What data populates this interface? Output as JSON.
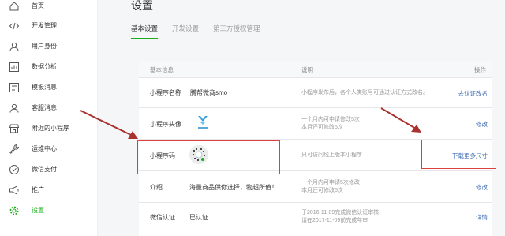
{
  "sidebar": {
    "items": [
      {
        "label": "首页",
        "icon": "home-icon"
      },
      {
        "label": "开发管理",
        "icon": "code-icon"
      },
      {
        "label": "用户身份",
        "icon": "user-icon"
      },
      {
        "label": "数据分析",
        "icon": "chart-icon"
      },
      {
        "label": "模板消息",
        "icon": "template-icon"
      },
      {
        "label": "客服消息",
        "icon": "customer-service-icon"
      },
      {
        "label": "附近的小程序",
        "icon": "store-icon"
      },
      {
        "label": "运维中心",
        "icon": "wrench-icon"
      },
      {
        "label": "微信支付",
        "icon": "pay-icon"
      },
      {
        "label": "推广",
        "icon": "megaphone-icon"
      },
      {
        "label": "设置",
        "icon": "gear-icon",
        "active": true
      }
    ]
  },
  "page": {
    "title": "设置"
  },
  "tabs": [
    {
      "label": "基本设置",
      "active": true
    },
    {
      "label": "开发设置"
    },
    {
      "label": "第三方授权管理"
    }
  ],
  "table": {
    "headers": {
      "info": "基本信息",
      "desc": "说明",
      "action": "操作"
    },
    "rows": [
      {
        "label": "小程序名称",
        "value": "腾帮微商smo",
        "desc": [
          "小程序发布后，各个人类账号可通过认证方式改名。"
        ],
        "action": "去认证改名"
      },
      {
        "label": "小程序头像",
        "value": "",
        "desc": [
          "一个月内可申请修改5次",
          "本月还可修改5次"
        ],
        "action": "修改"
      },
      {
        "label": "小程序码",
        "value": "",
        "desc": [
          "只可访问线上版本小程序"
        ],
        "action": "下载更多尺寸"
      },
      {
        "label": "介绍",
        "value": "海量商品供你选择，物超所值！",
        "desc": [
          "一个月内可申请5次修改",
          "本月还可修改5次"
        ],
        "action": "修改"
      },
      {
        "label": "微信认证",
        "value": "已认证",
        "desc": [
          "于2016-11-09完成微信认证审核",
          "请在2017-11-09前完成年审"
        ],
        "action": "详情"
      }
    ]
  },
  "colors": {
    "accent": "#1aad19",
    "link": "#3d6cb6",
    "highlight": "#d9423c"
  }
}
